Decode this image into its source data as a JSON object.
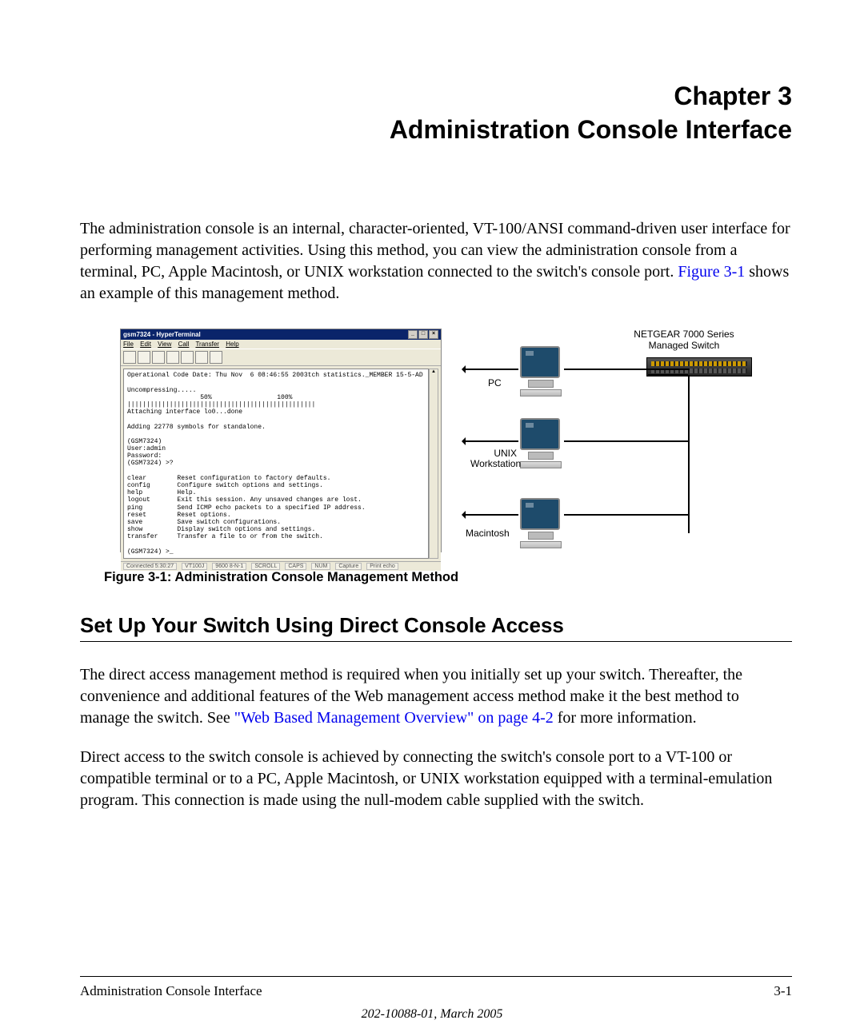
{
  "chapter": {
    "number": "Chapter 3",
    "title": "Administration Console Interface"
  },
  "intro": {
    "part1": "The administration console is an internal, character-oriented, VT-100/ANSI command-driven user interface for performing management activities. Using this method, you can view the administration console from a terminal, PC, Apple Macintosh, or UNIX workstation connected to the switch's console port. ",
    "figref": "Figure 3-1",
    "part2": " shows an example of this management method."
  },
  "hyperterm": {
    "title": "gsm7324 - HyperTerminal",
    "menus": [
      "File",
      "Edit",
      "View",
      "Call",
      "Transfer",
      "Help"
    ],
    "terminal": "Operational Code Date: Thu Nov  6 08:46:55 2003tch statistics._MEMBER 15-5-AD\n\nUncompressing.....\n                   50%                 100%\n|||||||||||||||||||||||||||||||||||||||||||||||||\nAttaching interface lo0...done\n\nAdding 22778 symbols for standalone.\n\n(GSM7324)\nUser:admin\nPassword:\n(GSM7324) >?\n\nclear        Reset configuration to factory defaults.\nconfig       Configure switch options and settings.\nhelp         Help.\nlogout       Exit this session. Any unsaved changes are lost.\nping         Send ICMP echo packets to a specified IP address.\nreset        Reset options.\nsave         Save switch configurations.\nshow         Display switch options and settings.\ntransfer     Transfer a file to or from the switch.\n\n(GSM7324) >_",
    "status": [
      "Connected 5:30:27",
      "VT100J",
      "9600 8-N-1",
      "SCROLL",
      "CAPS",
      "NUM",
      "Capture",
      "Print echo"
    ]
  },
  "diagram": {
    "switch_label1": "NETGEAR 7000 Series",
    "switch_label2": "Managed Switch",
    "pc": "PC",
    "unix1": "UNIX",
    "unix2": "Workstation",
    "mac": "Macintosh"
  },
  "figure_caption": "Figure 3-1:  Administration Console Management Method",
  "section_heading": "Set Up Your Switch Using Direct Console Access",
  "para1": {
    "a": "The direct access management method is required when you initially set up your switch. Thereafter, the convenience and additional features of the Web management access method make it the best method to manage the switch. See ",
    "link": "\"Web Based Management Overview\" on page 4-2",
    "b": " for more information."
  },
  "para2": "Direct access to the switch console is achieved by connecting the switch's console port to a VT-100 or compatible terminal or to a PC, Apple Macintosh, or UNIX workstation equipped with a terminal-emulation program. This connection is made using the null-modem cable supplied with the switch.",
  "footer": {
    "left": "Administration Console Interface",
    "right": "3-1",
    "doc": "202-10088-01, March 2005"
  }
}
